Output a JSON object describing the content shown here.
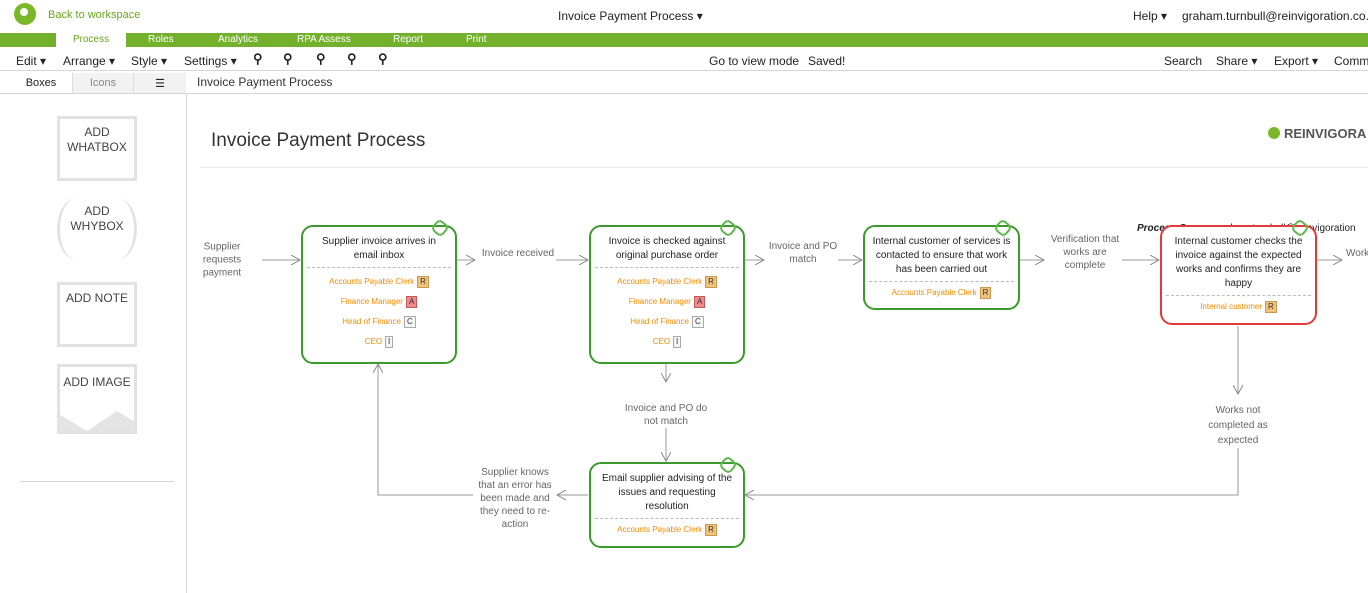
{
  "topbar": {
    "back_label": "Back to workspace",
    "doc_title": "Invoice Payment Process",
    "help_label": "Help",
    "user_email": "graham.turnbull@reinvigoration.co.uk"
  },
  "tabs": [
    "Process",
    "Roles",
    "Analytics",
    "RPA Assess",
    "Report",
    "Print"
  ],
  "menu": {
    "edit": "Edit",
    "arrange": "Arrange",
    "style": "Style",
    "settings": "Settings",
    "view_mode": "Go to view mode",
    "saved": "Saved!",
    "search": "Search",
    "share": "Share",
    "export": "Export",
    "comments": "Comm"
  },
  "panel_tabs": [
    "Boxes",
    "Icons"
  ],
  "breadcrumb": "Invoice Payment Process",
  "palette": {
    "whatbox": "ADD WHATBOX",
    "whybox": "ADD WHYBOX",
    "note": "ADD NOTE",
    "image": "ADD IMAGE"
  },
  "canvas": {
    "title": "Invoice Payment Process",
    "brand": "REINVIGORA",
    "owner_label": "Process Owner:",
    "owner_value": "graham.turnbull@reinvigoration"
  },
  "boxes": [
    {
      "title": "Supplier invoice arrives in email inbox",
      "roles": [
        {
          "name": "Accounts Payable Clerk",
          "raci": "R"
        },
        {
          "name": "Finance Manager",
          "raci": "A"
        },
        {
          "name": "Head of Finance",
          "raci": "C"
        },
        {
          "name": "CEO",
          "raci": "I"
        }
      ]
    },
    {
      "title": "Invoice is checked against original purchase order",
      "roles": [
        {
          "name": "Accounts Payable Clerk",
          "raci": "R"
        },
        {
          "name": "Finance Manager",
          "raci": "A"
        },
        {
          "name": "Head of Finance",
          "raci": "C"
        },
        {
          "name": "CEO",
          "raci": "I"
        }
      ]
    },
    {
      "title": "Internal customer of services is contacted to ensure that work has been carried out",
      "roles": [
        {
          "name": "Accounts Payable Clerk",
          "raci": "R"
        }
      ]
    },
    {
      "title": "Internal customer checks the invoice against the expected works and confirms they are happy",
      "roles": [
        {
          "name": "Internal customer",
          "raci": "R"
        }
      ]
    },
    {
      "title": "Email supplier advising of the issues and requesting resolution",
      "roles": [
        {
          "name": "Accounts Payable Clerk",
          "raci": "R"
        }
      ]
    }
  ],
  "whys": {
    "supplier_requests": "Supplier requests payment",
    "invoice_received": "Invoice received",
    "po_match": "Invoice and PO match",
    "verification": "Verification that works are complete",
    "works_cut": "Work",
    "po_no_match": "Invoice and PO do not match",
    "works_not_completed": "Works not completed as expected",
    "supplier_knows": "Supplier knows that an error has been made and they need to re-action"
  },
  "colors": {
    "brand_green": "#73b12d",
    "box_green": "#3a9a2b",
    "box_red": "#e03a3a",
    "role_orange": "#f08c00"
  }
}
